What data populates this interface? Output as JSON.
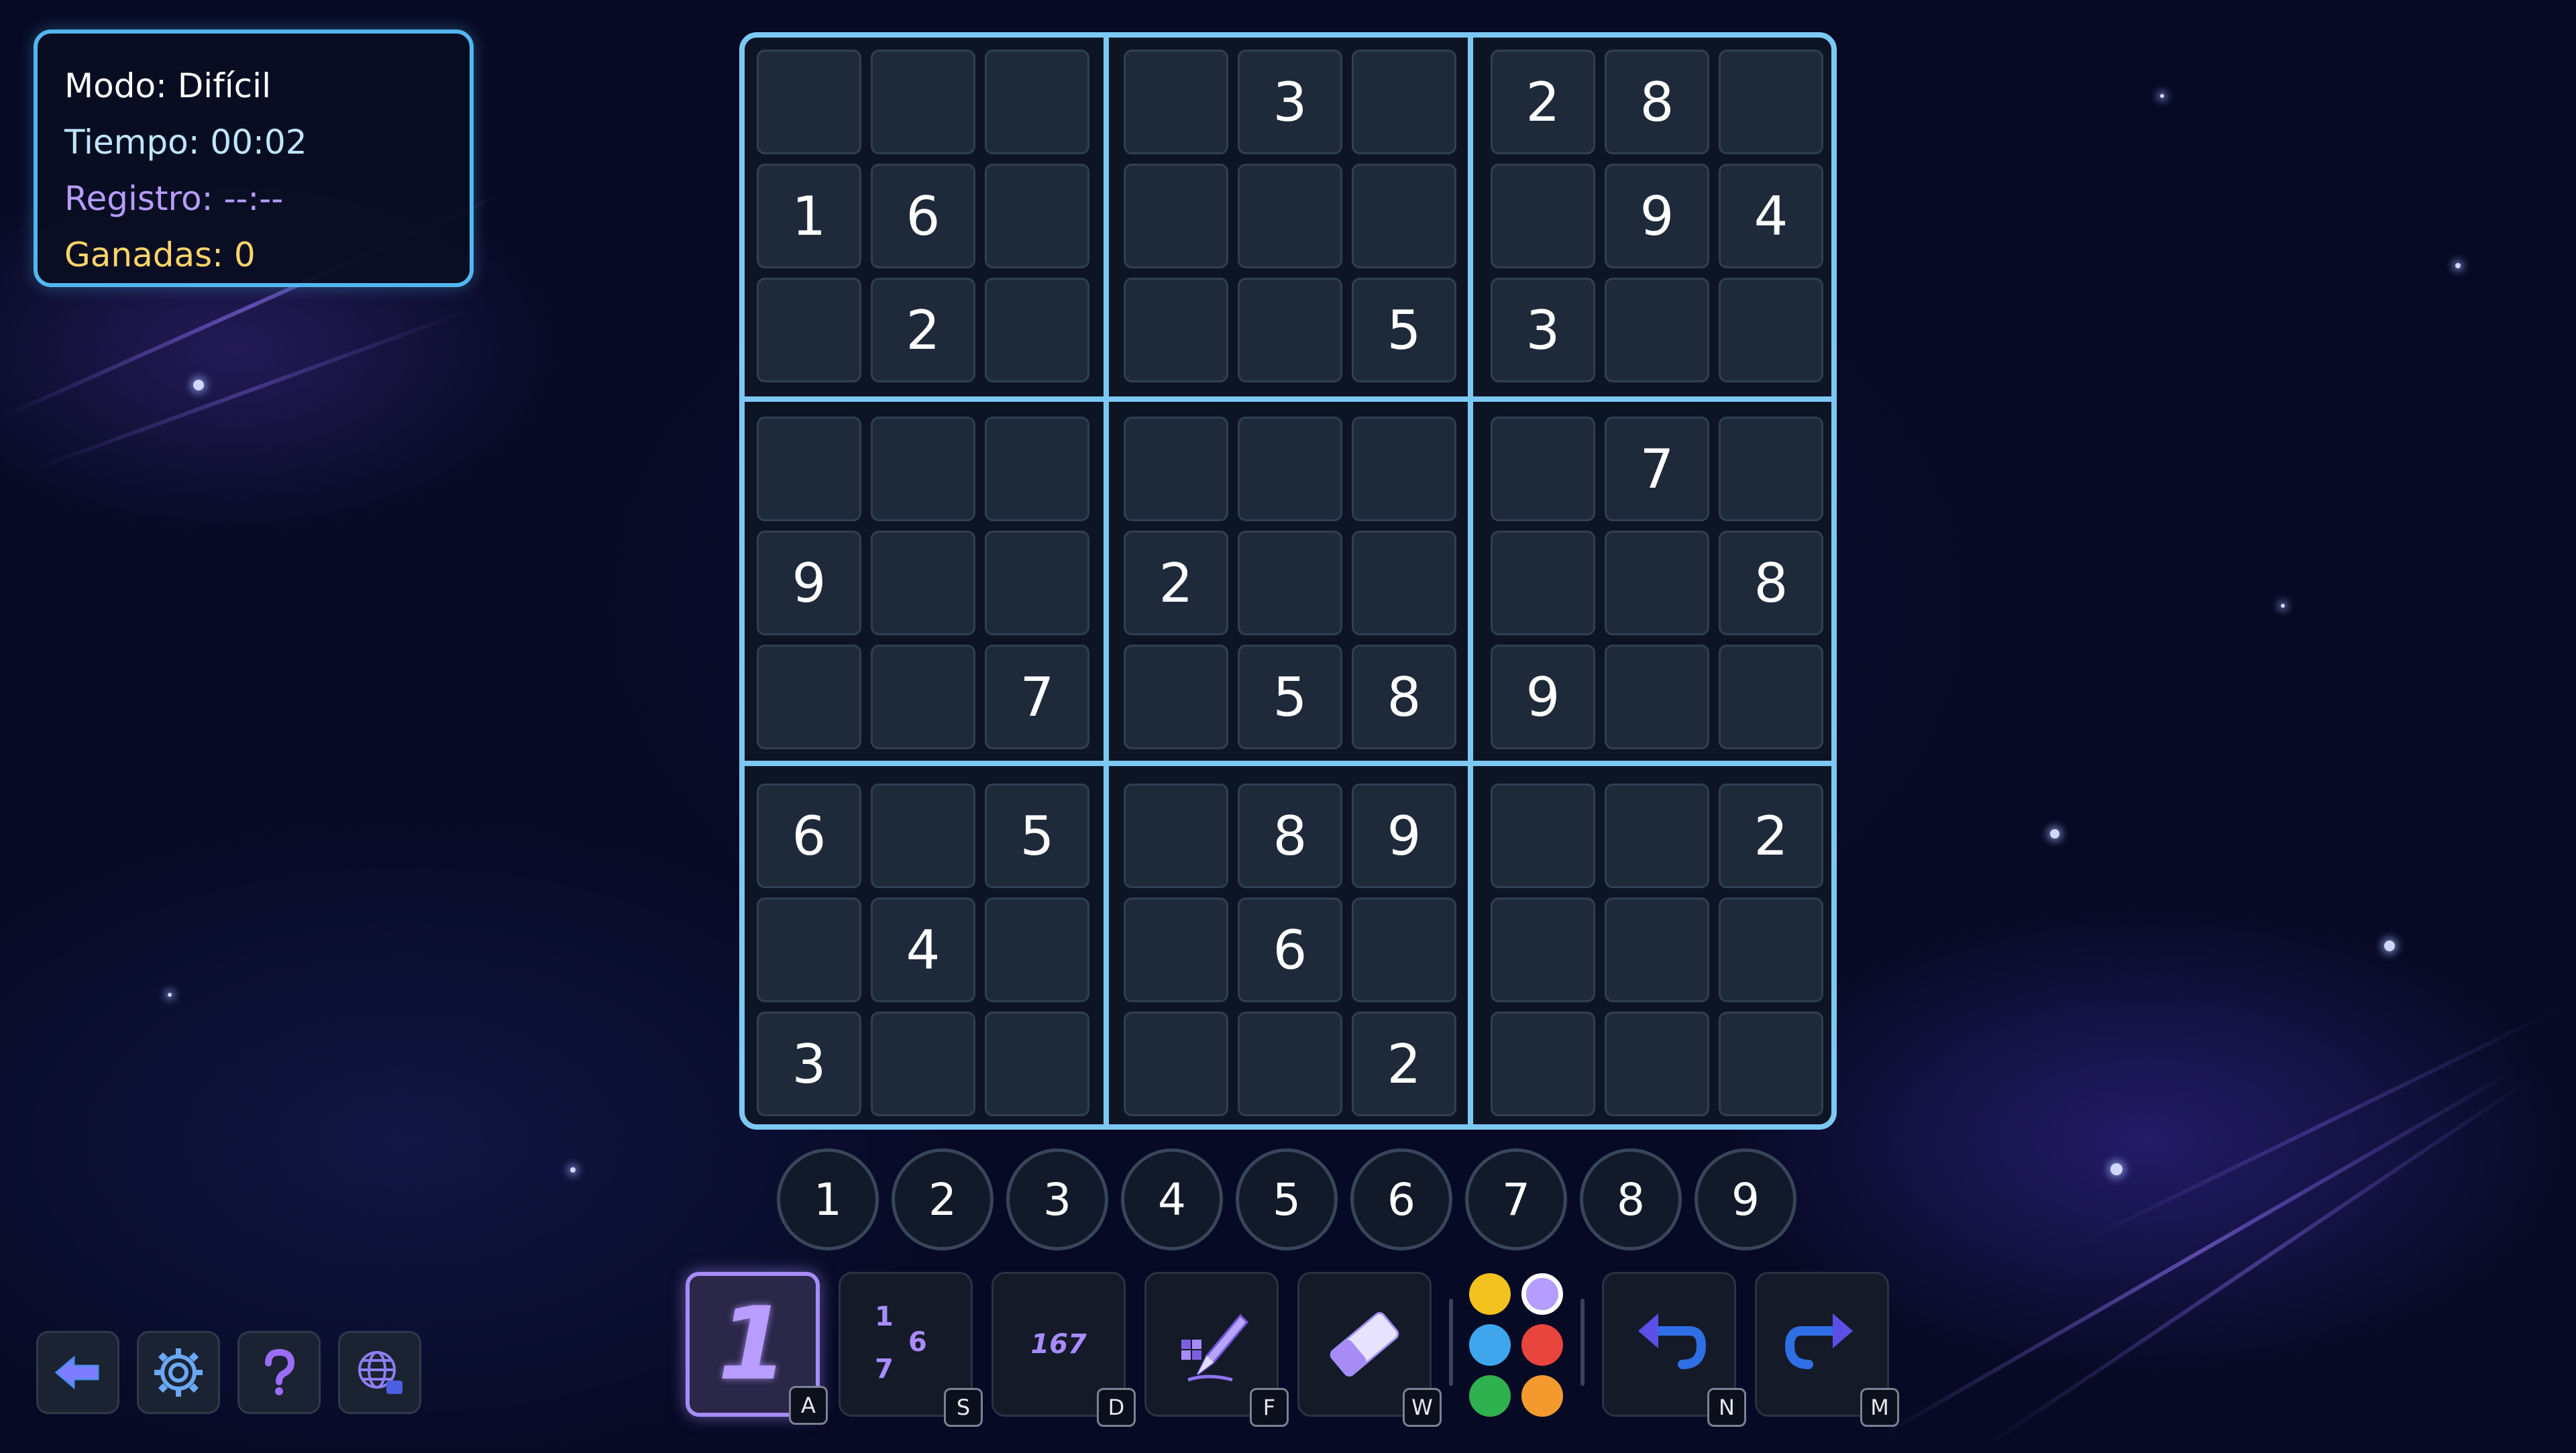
{
  "info": {
    "mode": "Modo: Difícil",
    "time": "Tiempo: 00:02",
    "record": "Registro: --:--",
    "wins": "Ganadas: 0"
  },
  "board": [
    [
      "",
      "",
      "",
      "",
      "3",
      "",
      "2",
      "8",
      ""
    ],
    [
      "1",
      "6",
      "",
      "",
      "",
      "",
      "",
      "9",
      "4"
    ],
    [
      "",
      "2",
      "",
      "",
      "",
      "5",
      "3",
      "",
      ""
    ],
    [
      "",
      "",
      "",
      "",
      "",
      "",
      "",
      "7",
      ""
    ],
    [
      "9",
      "",
      "",
      "2",
      "",
      "",
      "",
      "",
      "8"
    ],
    [
      "",
      "",
      "7",
      "",
      "5",
      "8",
      "9",
      "",
      ""
    ],
    [
      "6",
      "",
      "5",
      "",
      "8",
      "9",
      "",
      "",
      "2"
    ],
    [
      "",
      "4",
      "",
      "",
      "6",
      "",
      "",
      "",
      ""
    ],
    [
      "3",
      "",
      "",
      "",
      "",
      "2",
      "",
      "",
      ""
    ]
  ],
  "number_pad": [
    "1",
    "2",
    "3",
    "4",
    "5",
    "6",
    "7",
    "8",
    "9"
  ],
  "tools": [
    {
      "name": "single-digit-mode",
      "icon": "digit-one-icon",
      "key": "A",
      "active": true
    },
    {
      "name": "candidates-mode",
      "icon": "candidate-notes-icon",
      "key": "S",
      "active": false
    },
    {
      "name": "multi-digit-mode",
      "icon": "multi-digit-icon",
      "key": "D",
      "active": false
    },
    {
      "name": "pen-mode",
      "icon": "pen-icon",
      "key": "F",
      "active": false
    },
    {
      "name": "eraser",
      "icon": "eraser-icon",
      "key": "W",
      "active": false
    },
    {
      "name": "undo",
      "icon": "undo-icon",
      "key": "N",
      "active": false
    },
    {
      "name": "redo",
      "icon": "redo-icon",
      "key": "M",
      "active": false
    }
  ],
  "tool_glyphs": {
    "single": "1",
    "candidates": [
      "1",
      "6",
      "7"
    ],
    "multi": "167"
  },
  "colors": [
    "#f4c21f",
    "#b59cff",
    "#3fa6ee",
    "#e8453c",
    "#2fb14f",
    "#f39a2f"
  ],
  "selected_color": "#b59cff",
  "side_buttons": [
    "back-arrow-icon",
    "gear-icon",
    "help-icon",
    "language-globe-icon"
  ]
}
